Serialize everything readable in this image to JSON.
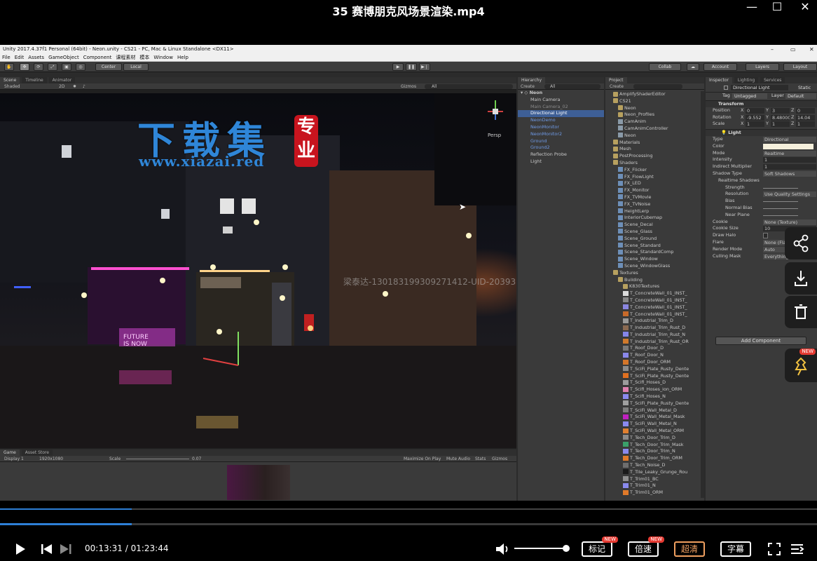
{
  "player": {
    "title": "35 赛博朋克风场景渲染.mp4",
    "time_current": "00:13:31",
    "time_total": "01:23:44",
    "time_sep": " / ",
    "progress_fraction": 0.161,
    "volume_fraction": 0.98,
    "buttons": {
      "mark": "标记",
      "speed": "倍速",
      "hd": "超清",
      "subtitle": "字幕"
    },
    "new_badge": "NEW"
  },
  "watermark": {
    "brand": "下载集",
    "seal": "专业",
    "url": "www.xiazai.red",
    "uid": "梁泰达-13018319930927141​2-UID-20393"
  },
  "unity": {
    "title": "Unity 2017.4.37f1 Personal (64bit) - Neon.unity - CS21 - PC, Mac & Linux Standalone <DX11>",
    "menu": [
      "File",
      "Edit",
      "Assets",
      "GameObject",
      "Component",
      "课程素材",
      "模本",
      "Window",
      "Help"
    ],
    "toolbar": {
      "center": "Center",
      "local": "Local",
      "collab": "Collab",
      "account": "Account",
      "layers": "Layers",
      "layout": "Layout"
    },
    "scene_tabs": [
      "Scene",
      "Timeline",
      "Animator"
    ],
    "scene_bar": {
      "shaded": "Shaded",
      "mode2d": "2D",
      "gizmos": "Gizmos",
      "search": "All"
    },
    "persp": "Persp",
    "game": {
      "tabs": [
        "Game",
        "Asset Store"
      ],
      "display": "Display 1",
      "resolution": "1920x1080",
      "scale_label": "Scale",
      "scale_value": "0.07",
      "options": [
        "Maximize On Play",
        "Mute Audio",
        "Stats",
        "Gizmos"
      ]
    },
    "hierarchy": {
      "tab": "Hierarchy",
      "create": "Create",
      "search": "All",
      "scene": "Neon",
      "items": [
        {
          "label": "Main Camera",
          "style": "hrow"
        },
        {
          "label": "Main Camera_02",
          "style": "gray"
        },
        {
          "label": "Directional Light",
          "style": "sel"
        },
        {
          "label": "NeonDemo",
          "style": "blue"
        },
        {
          "label": "NeonMonitor",
          "style": "blue"
        },
        {
          "label": "NeonMonitor2",
          "style": "blue"
        },
        {
          "label": "Ground",
          "style": "blue"
        },
        {
          "label": "Ground2",
          "style": "blue"
        },
        {
          "label": "Reflection Probe",
          "style": "hrow"
        },
        {
          "label": "Light",
          "style": "hrow"
        }
      ]
    },
    "project": {
      "tab": "Project",
      "create": "Create",
      "items": [
        {
          "label": "AmplifyShaderEditor",
          "t": "folder",
          "d": 1
        },
        {
          "label": "CS21",
          "t": "folder",
          "d": 1
        },
        {
          "label": "Neon",
          "t": "folder",
          "d": 2
        },
        {
          "label": "Neon_Profiles",
          "t": "folder",
          "d": 2
        },
        {
          "label": "CamAnim",
          "t": "file",
          "d": 2
        },
        {
          "label": "CamAnimController",
          "t": "file",
          "d": 2
        },
        {
          "label": "Neon",
          "t": "file",
          "d": 2
        },
        {
          "label": "Materials",
          "t": "folder",
          "d": 1
        },
        {
          "label": "Mesh",
          "t": "folder",
          "d": 1
        },
        {
          "label": "PostProcessing",
          "t": "folder",
          "d": 1
        },
        {
          "label": "Shaders",
          "t": "folder",
          "d": 1
        },
        {
          "label": "FX_Flicker",
          "t": "shader",
          "d": 2
        },
        {
          "label": "FX_FlowLight",
          "t": "shader",
          "d": 2
        },
        {
          "label": "FX_LED",
          "t": "shader",
          "d": 2
        },
        {
          "label": "FX_Monitor",
          "t": "shader",
          "d": 2
        },
        {
          "label": "FX_TVMovie",
          "t": "shader",
          "d": 2
        },
        {
          "label": "FX_TVNoise",
          "t": "shader",
          "d": 2
        },
        {
          "label": "HeightLerp",
          "t": "shader",
          "d": 2
        },
        {
          "label": "InteriorCubemap",
          "t": "shader",
          "d": 2
        },
        {
          "label": "Scene_Decal",
          "t": "shader",
          "d": 2
        },
        {
          "label": "Scene_Glass",
          "t": "shader",
          "d": 2
        },
        {
          "label": "Scene_Ground",
          "t": "shader",
          "d": 2
        },
        {
          "label": "Scene_Standard",
          "t": "shader",
          "d": 2
        },
        {
          "label": "Scene_StandardComp",
          "t": "shader",
          "d": 2
        },
        {
          "label": "Scene_Window",
          "t": "shader",
          "d": 2
        },
        {
          "label": "Scene_WindowGlass",
          "t": "shader",
          "d": 2
        },
        {
          "label": "Textures",
          "t": "folder",
          "d": 1
        },
        {
          "label": "Building",
          "t": "folder",
          "d": 2
        },
        {
          "label": "K830Textures",
          "t": "folder",
          "d": 3
        },
        {
          "label": "T_ConcreteWall_01_INST_",
          "t": "tex",
          "d": 3,
          "c": "#dcdcdc"
        },
        {
          "label": "T_ConcreteWall_01_INST_",
          "t": "tex",
          "d": 3,
          "c": "#888888"
        },
        {
          "label": "T_ConcreteWall_01_INST_",
          "t": "tex",
          "d": 3,
          "c": "#8b86e0"
        },
        {
          "label": "T_ConcreteWall_01_INST_",
          "t": "tex",
          "d": 3,
          "c": "#c86a2a"
        },
        {
          "label": "T_Industrial_Trim_D",
          "t": "tex",
          "d": 3,
          "c": "#9a9a9a"
        },
        {
          "label": "T_Industrial_Trim_Rust_D",
          "t": "tex",
          "d": 3,
          "c": "#8a6a52"
        },
        {
          "label": "T_Industrial_Trim_Rust_N",
          "t": "tex",
          "d": 3,
          "c": "#8586e8"
        },
        {
          "label": "T_Industrial_Trim_Rust_OR",
          "t": "tex",
          "d": 3,
          "c": "#d07a2c"
        },
        {
          "label": "T_Roof_Door_D",
          "t": "tex",
          "d": 3,
          "c": "#7a7a7a"
        },
        {
          "label": "T_Roof_Door_N",
          "t": "tex",
          "d": 3,
          "c": "#8a88ea"
        },
        {
          "label": "T_Roof_Door_ORM",
          "t": "tex",
          "d": 3,
          "c": "#d4762a"
        },
        {
          "label": "T_SciFi_Plate_Rusty_Dente",
          "t": "tex",
          "d": 3,
          "c": "#8c8c8c"
        },
        {
          "label": "T_SciFi_Plate_Rusty_Dente",
          "t": "tex",
          "d": 3,
          "c": "#e07020"
        },
        {
          "label": "T_Scifi_Hoses_D",
          "t": "tex",
          "d": 3,
          "c": "#9c9c9c"
        },
        {
          "label": "T_Scifi_Hoses_ion_ORM",
          "t": "tex",
          "d": 3,
          "c": "#e080b0"
        },
        {
          "label": "T_Scifi_Hoses_N",
          "t": "tex",
          "d": 3,
          "c": "#8c8aee"
        },
        {
          "label": "T_SciFi_Plate_Rusty_Dente",
          "t": "tex",
          "d": 3,
          "c": "#a0a0a0"
        },
        {
          "label": "T_SciFi_Wall_Metal_D",
          "t": "tex",
          "d": 3,
          "c": "#7e7e7e"
        },
        {
          "label": "T_SciFi_Wall_Metal_Mask",
          "t": "tex",
          "d": 3,
          "c": "#c020c0"
        },
        {
          "label": "T_SciFi_Wall_Metal_N",
          "t": "tex",
          "d": 3,
          "c": "#8a8aee"
        },
        {
          "label": "T_SciFi_Wall_Metal_ORM",
          "t": "tex",
          "d": 3,
          "c": "#e08030"
        },
        {
          "label": "T_Tech_Door_Trim_D",
          "t": "tex",
          "d": 3,
          "c": "#8a8a8a"
        },
        {
          "label": "T_Tech_Door_Trim_Mask",
          "t": "tex",
          "d": 3,
          "c": "#3aa06a"
        },
        {
          "label": "T_Tech_Door_Trim_N",
          "t": "tex",
          "d": 3,
          "c": "#8a8aee"
        },
        {
          "label": "T_Tech_Door_Trim_ORM",
          "t": "tex",
          "d": 3,
          "c": "#e07a2a"
        },
        {
          "label": "T_Tech_Noise_D",
          "t": "tex",
          "d": 3,
          "c": "#6e6e6e"
        },
        {
          "label": "T_Tile_Leaky_Grunge_Rou",
          "t": "tex",
          "d": 3,
          "c": "#1a1a1a"
        },
        {
          "label": "T_Trim01_BC",
          "t": "tex",
          "d": 3,
          "c": "#909090"
        },
        {
          "label": "T_Trim01_N",
          "t": "tex",
          "d": 3,
          "c": "#8a8aee"
        },
        {
          "label": "T_Trim01_ORM",
          "t": "tex",
          "d": 3,
          "c": "#e07a2a"
        }
      ]
    },
    "inspector": {
      "tabs": [
        "Inspector",
        "Lighting",
        "Services"
      ],
      "object_name": "Directional Light",
      "static": "Static",
      "tag_label": "Tag",
      "tag_value": "Untagged",
      "layer_label": "Layer",
      "layer_value": "Default",
      "transform_title": "Transform",
      "position_label": "Position",
      "rotation_label": "Rotation",
      "scale_label": "Scale",
      "position": [
        "0",
        "3",
        "0"
      ],
      "rotation": [
        "-9.552",
        "8.48000",
        "14.04"
      ],
      "scale": [
        "1",
        "1",
        "1"
      ],
      "light_title": "Light",
      "props": [
        {
          "label": "Type",
          "value": "Directional",
          "kind": "dd"
        },
        {
          "label": "Color",
          "value": "",
          "kind": "color"
        },
        {
          "label": "Mode",
          "value": "Realtime",
          "kind": "dd"
        },
        {
          "label": "Intensity",
          "value": "1",
          "kind": "num"
        },
        {
          "label": "Indirect Multiplier",
          "value": "1",
          "kind": "num"
        },
        {
          "label": "Shadow Type",
          "value": "Soft Shadows",
          "kind": "dd"
        },
        {
          "label": "Realtime Shadows",
          "value": "",
          "kind": "head"
        },
        {
          "label": "Strength",
          "value": "",
          "kind": "slider"
        },
        {
          "label": "Resolution",
          "value": "Use Quality Settings",
          "kind": "dd"
        },
        {
          "label": "Bias",
          "value": "",
          "kind": "slider"
        },
        {
          "label": "Normal Bias",
          "value": "",
          "kind": "slider"
        },
        {
          "label": "Near Plane",
          "value": "",
          "kind": "slider"
        },
        {
          "label": "Cookie",
          "value": "None (Texture)",
          "kind": "dd"
        },
        {
          "label": "Cookie Size",
          "value": "10",
          "kind": "num"
        },
        {
          "label": "Draw Halo",
          "value": "",
          "kind": "check"
        },
        {
          "label": "Flare",
          "value": "None (Flare)",
          "kind": "dd"
        },
        {
          "label": "Render Mode",
          "value": "Auto",
          "kind": "dd"
        },
        {
          "label": "Culling Mask",
          "value": "Everything",
          "kind": "dd"
        }
      ],
      "add_component": "Add Component"
    }
  },
  "colors": {
    "accent": "#2d7fd6",
    "new_badge": "#e53a32",
    "unity_bg": "#3a3a3a",
    "selection": "#3e5f96"
  }
}
